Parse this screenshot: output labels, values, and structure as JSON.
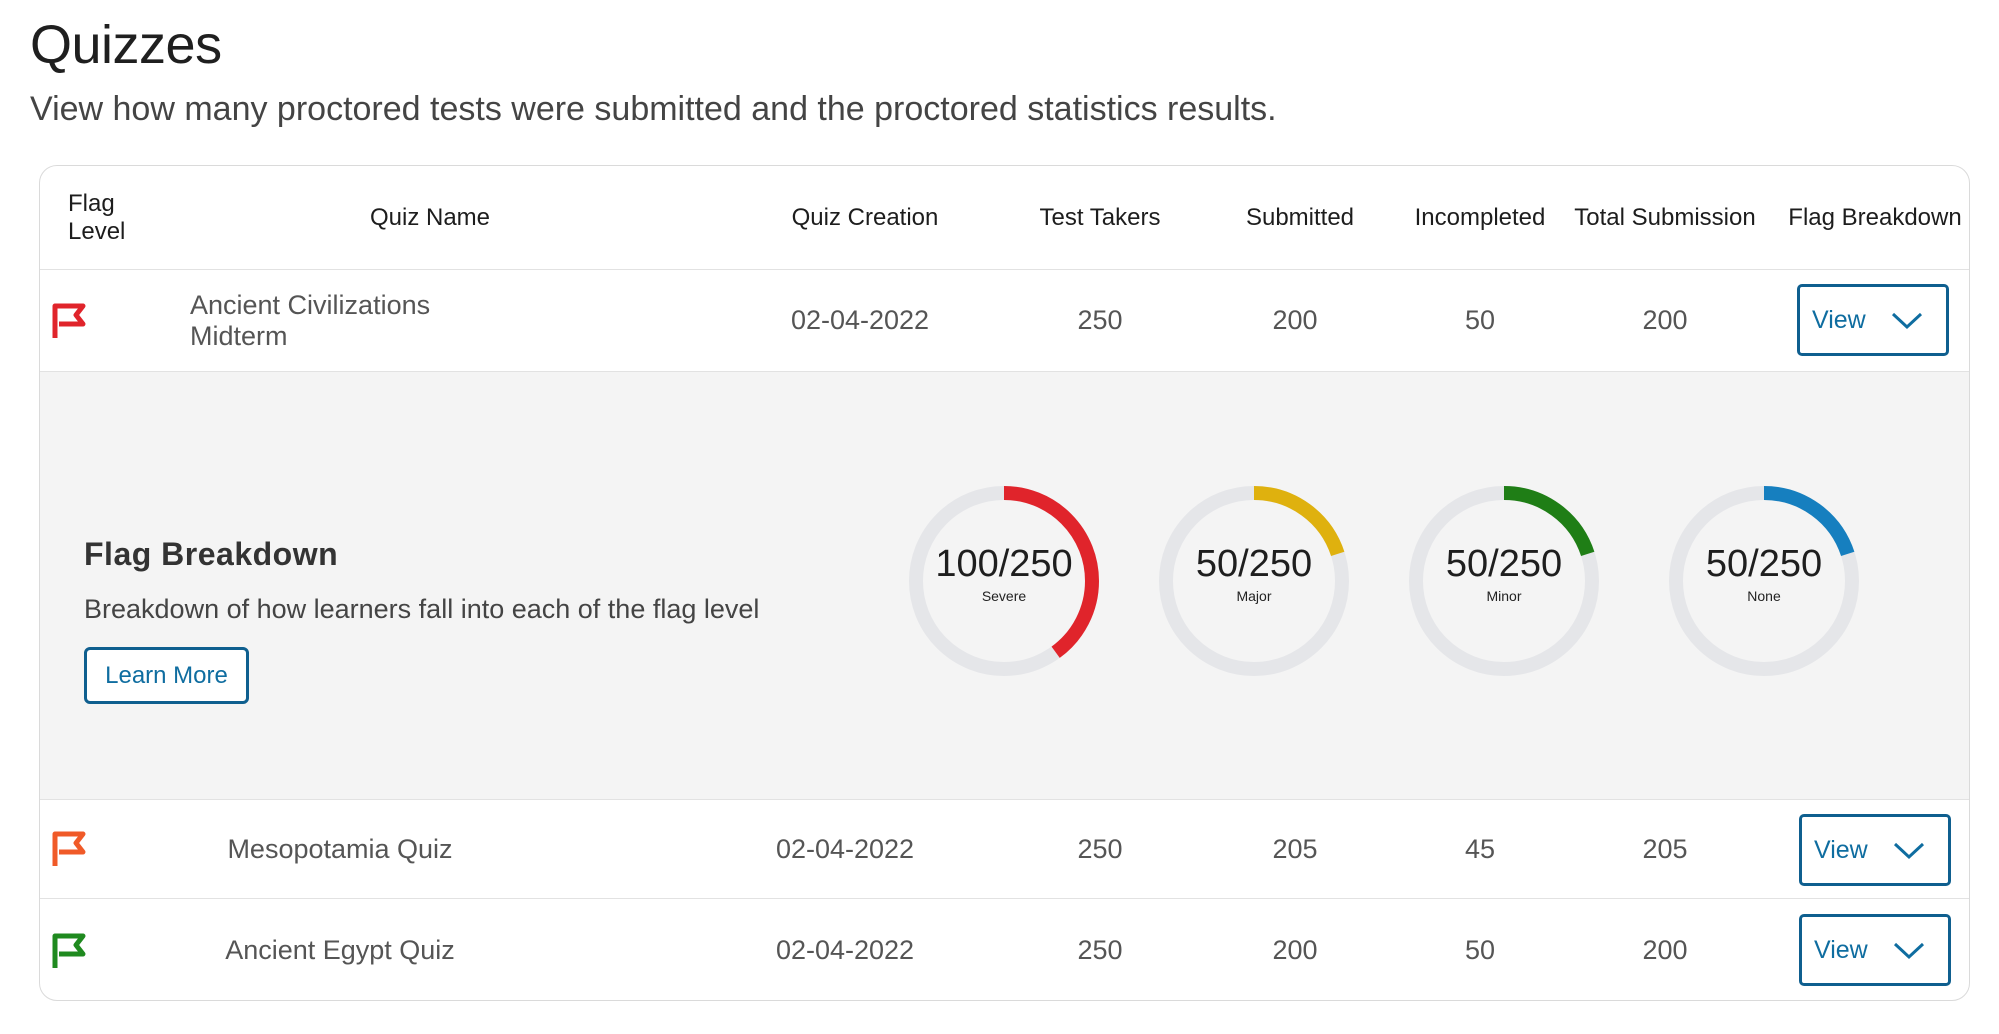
{
  "page": {
    "title": "Quizzes",
    "subtitle": "View how many proctored tests were submitted and the proctored statistics results."
  },
  "table": {
    "headers": [
      "Flag Level",
      "Quiz Name",
      "Quiz Creation",
      "Test Takers",
      "Submitted",
      "Incompleted",
      "Total Submission",
      "Flag Breakdown"
    ],
    "rows": [
      {
        "flag_icon": "flag-icon",
        "flag_color": "#e0242b",
        "name": "Ancient Civilizations Midterm",
        "created": "02-04-2022",
        "test_takers": "250",
        "submitted": "200",
        "incompleted": "50",
        "total_submission": "200",
        "action": "View"
      },
      {
        "flag_icon": "flag-icon",
        "flag_color": "#f05a28",
        "name": "Mesopotamia Quiz",
        "created": "02-04-2022",
        "test_takers": "250",
        "submitted": "205",
        "incompleted": "45",
        "total_submission": "205",
        "action": "View"
      },
      {
        "flag_icon": "flag-icon",
        "flag_color": "#1f8a1f",
        "name": "Ancient Egypt Quiz",
        "created": "02-04-2022",
        "test_takers": "250",
        "submitted": "200",
        "incompleted": "50",
        "total_submission": "200",
        "action": "View"
      }
    ]
  },
  "breakdown": {
    "title": "Flag Breakdown",
    "description": "Breakdown of how learners fall into each of the flag level",
    "learn_more": "Learn More",
    "track_color": "#e5e6e9",
    "donuts": [
      {
        "value": "100/250",
        "label": "Severe",
        "fraction": 0.4,
        "color": "#e0242b"
      },
      {
        "value": "50/250",
        "label": "Major",
        "fraction": 0.2,
        "color": "#dfb10e"
      },
      {
        "value": "50/250",
        "label": "Minor",
        "fraction": 0.2,
        "color": "#1f7e16"
      },
      {
        "value": "50/250",
        "label": "None",
        "fraction": 0.2,
        "color": "#167fbf"
      }
    ]
  }
}
